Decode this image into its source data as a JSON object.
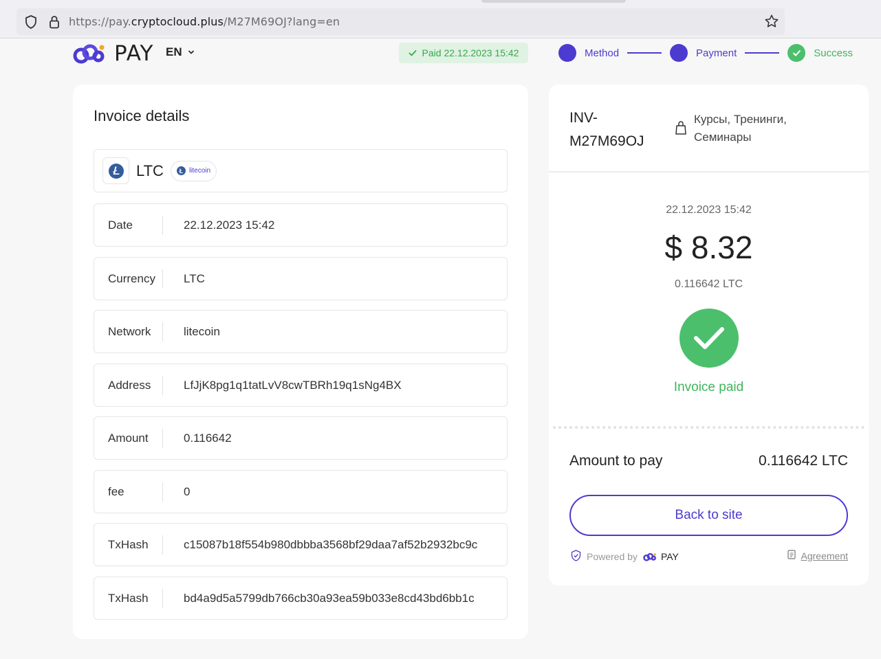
{
  "browser": {
    "url_prefix": "https://pay.",
    "url_domain": "cryptocloud.plus",
    "url_path": "/M27M69OJ?lang=en"
  },
  "header": {
    "logo_text": "PAY",
    "language": "EN",
    "paid_badge": "Paid 22.12.2023 15:42",
    "steps": [
      {
        "label": "Method"
      },
      {
        "label": "Payment"
      },
      {
        "label": "Success"
      }
    ]
  },
  "details": {
    "title": "Invoice details",
    "coin": "LTC",
    "network_pill": "litecoin",
    "rows": [
      {
        "key": "Date",
        "value": "22.12.2023 15:42"
      },
      {
        "key": "Currency",
        "value": "LTC"
      },
      {
        "key": "Network",
        "value": "litecoin"
      },
      {
        "key": "Address",
        "value": "LfJjK8pg1q1tatLvV8cwTBRh19q1sNg4BX"
      },
      {
        "key": "Amount",
        "value": "0.116642"
      },
      {
        "key": "fee",
        "value": "0"
      },
      {
        "key": "TxHash",
        "value": "c15087b18f554b980dbbba3568bf29daa7af52b2932bc9c"
      },
      {
        "key": "TxHash",
        "value": "bd4a9d5a5799db766cb30a93ea59b033e8cd43bd6bb1c"
      }
    ]
  },
  "summary": {
    "invoice_id": "INV-M27M69OJ",
    "category": "Курсы, Тренинги, Семинары",
    "date": "22.12.2023 15:42",
    "amount_usd": "$ 8.32",
    "amount_crypto": "0.116642 LTC",
    "status": "Invoice paid",
    "amount_to_pay_label": "Amount to pay",
    "amount_to_pay_value": "0.116642 LTC",
    "back_button": "Back to site",
    "powered_by": "Powered by",
    "powered_logo": "PAY",
    "agreement": "Agreement"
  },
  "colors": {
    "accent": "#4c3bcf",
    "success": "#4cbf6c",
    "background": "#f7f7f7"
  }
}
